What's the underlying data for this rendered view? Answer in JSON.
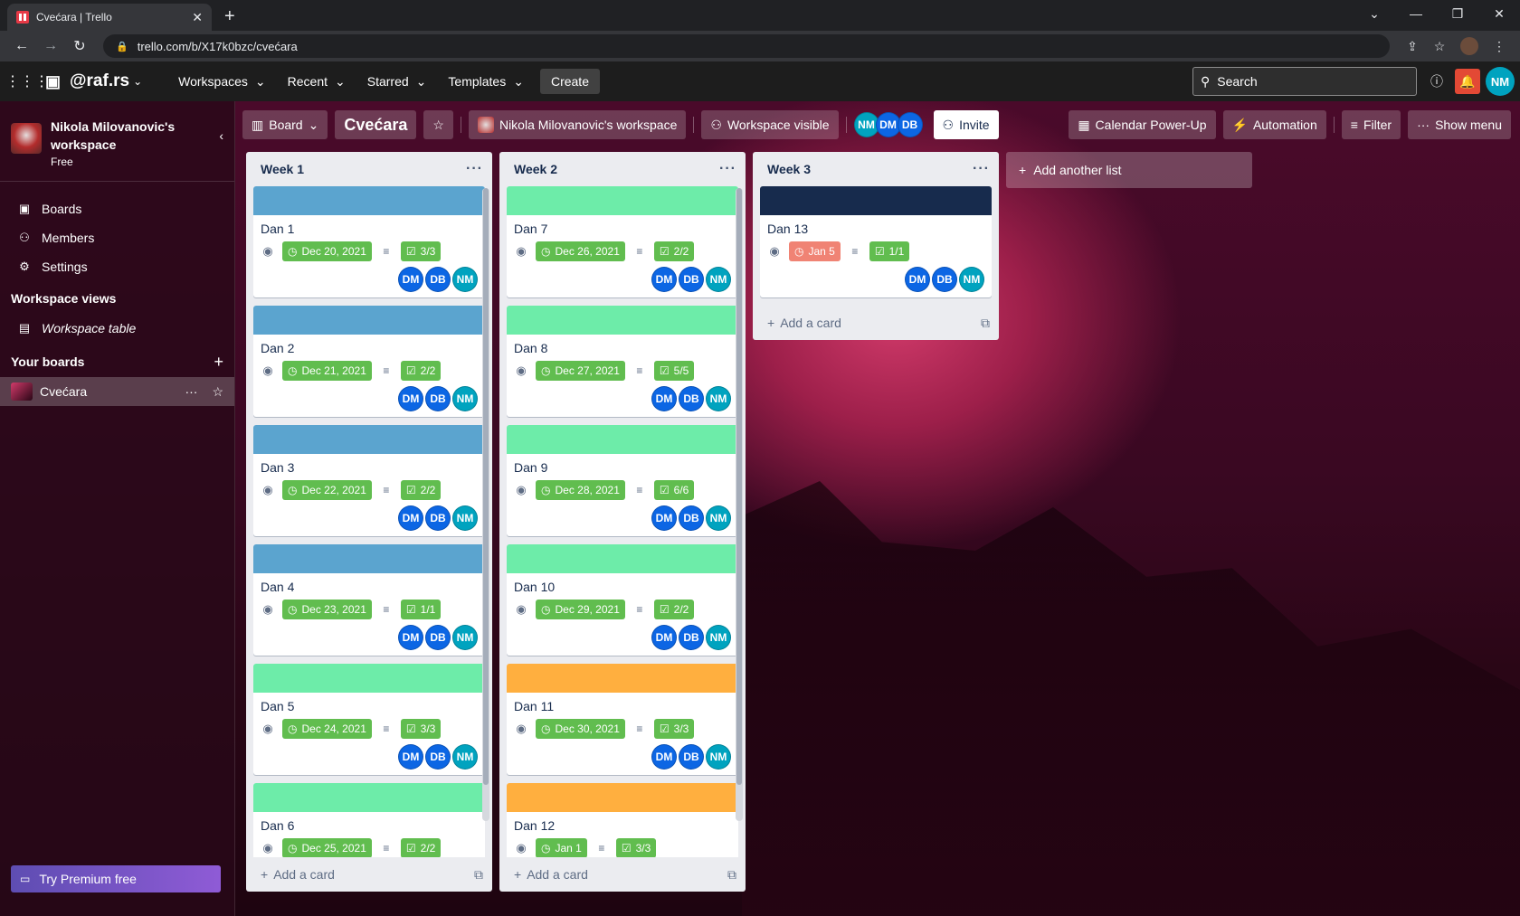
{
  "browser": {
    "tab_title": "Cvećara | Trello",
    "url": "trello.com/b/X17k0bzc/cvećara"
  },
  "header": {
    "workspace_brand": "@raf.rs",
    "menus": [
      "Workspaces",
      "Recent",
      "Starred",
      "Templates"
    ],
    "create_label": "Create",
    "search_placeholder": "Search",
    "user_initials": "NM"
  },
  "sidebar": {
    "workspace_name": "Nikola Milovanovic's workspace",
    "plan": "Free",
    "nav": [
      {
        "label": "Boards",
        "icon": "trello-board-icon"
      },
      {
        "label": "Members",
        "icon": "person-icon"
      },
      {
        "label": "Settings",
        "icon": "gear-icon"
      }
    ],
    "views_title": "Workspace views",
    "views": [
      {
        "label": "Workspace table",
        "icon": "table-icon"
      }
    ],
    "your_boards_title": "Your boards",
    "boards": [
      {
        "label": "Cvećara"
      }
    ],
    "premium_label": "Try Premium free"
  },
  "board_header": {
    "view_label": "Board",
    "title": "Cvećara",
    "workspace_label": "Nikola Milovanovic's workspace",
    "visibility_label": "Workspace visible",
    "members": [
      "NM",
      "DM",
      "DB"
    ],
    "invite_label": "Invite",
    "calendar_label": "Calendar Power-Up",
    "automation_label": "Automation",
    "filter_label": "Filter",
    "show_menu_label": "Show menu"
  },
  "colors": {
    "blue_cover": "#5ba4cf",
    "green_cover": "#6deca9",
    "orange_cover": "#ffaf3f",
    "navy_cover": "#172b4d",
    "badge_green": "#61bd4f",
    "badge_red": "#eb5a46"
  },
  "lists": [
    {
      "title": "Week 1",
      "cards": [
        {
          "title": "Dan 1",
          "cover": "#5ba4cf",
          "due": "Dec 20, 2021",
          "checklist": "3/3",
          "members": [
            "DM",
            "DB",
            "NM"
          ]
        },
        {
          "title": "Dan 2",
          "cover": "#5ba4cf",
          "due": "Dec 21, 2021",
          "checklist": "2/2",
          "members": [
            "DM",
            "DB",
            "NM"
          ]
        },
        {
          "title": "Dan 3",
          "cover": "#5ba4cf",
          "due": "Dec 22, 2021",
          "checklist": "2/2",
          "members": [
            "DM",
            "DB",
            "NM"
          ]
        },
        {
          "title": "Dan 4",
          "cover": "#5ba4cf",
          "due": "Dec 23, 2021",
          "checklist": "1/1",
          "members": [
            "DM",
            "DB",
            "NM"
          ]
        },
        {
          "title": "Dan 5",
          "cover": "#6deca9",
          "due": "Dec 24, 2021",
          "checklist": "3/3",
          "members": [
            "DM",
            "DB",
            "NM"
          ]
        },
        {
          "title": "Dan 6",
          "cover": "#6deca9",
          "due": "Dec 25, 2021",
          "checklist": "2/2",
          "members": []
        }
      ],
      "add_card_label": "Add a card"
    },
    {
      "title": "Week 2",
      "cards": [
        {
          "title": "Dan 7",
          "cover": "#6deca9",
          "due": "Dec 26, 2021",
          "checklist": "2/2",
          "members": [
            "DM",
            "DB",
            "NM"
          ]
        },
        {
          "title": "Dan 8",
          "cover": "#6deca9",
          "due": "Dec 27, 2021",
          "checklist": "5/5",
          "members": [
            "DM",
            "DB",
            "NM"
          ]
        },
        {
          "title": "Dan 9",
          "cover": "#6deca9",
          "due": "Dec 28, 2021",
          "checklist": "6/6",
          "members": [
            "DM",
            "DB",
            "NM"
          ]
        },
        {
          "title": "Dan 10",
          "cover": "#6deca9",
          "due": "Dec 29, 2021",
          "checklist": "2/2",
          "members": [
            "DM",
            "DB",
            "NM"
          ]
        },
        {
          "title": "Dan 11",
          "cover": "#ffaf3f",
          "due": "Dec 30, 2021",
          "checklist": "3/3",
          "members": [
            "DM",
            "DB",
            "NM"
          ]
        },
        {
          "title": "Dan 12",
          "cover": "#ffaf3f",
          "due": "Jan 1",
          "checklist": "3/3",
          "members": []
        }
      ],
      "add_card_label": "Add a card"
    },
    {
      "title": "Week 3",
      "cards": [
        {
          "title": "Dan 13",
          "cover": "#172b4d",
          "due": "Jan 5",
          "due_overdue": true,
          "checklist": "1/1",
          "members": [
            "DM",
            "DB",
            "NM"
          ]
        }
      ],
      "add_card_label": "Add a card"
    }
  ],
  "add_list_label": "Add another list"
}
